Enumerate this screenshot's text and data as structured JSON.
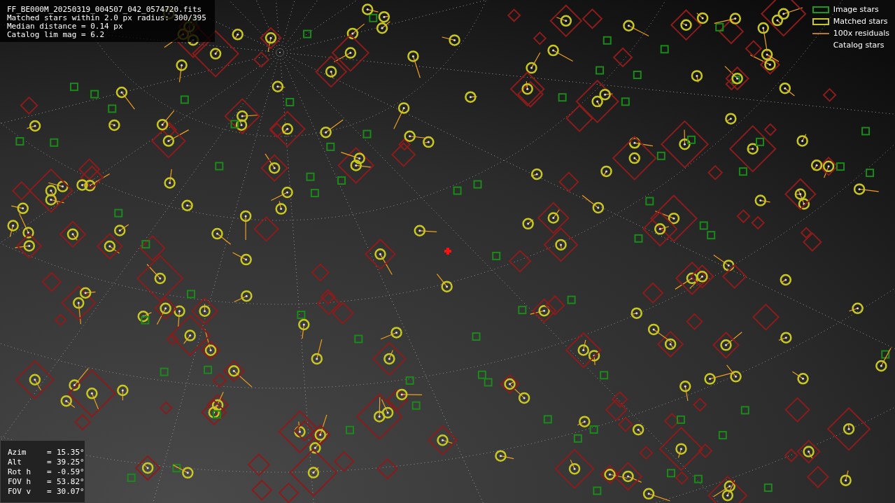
{
  "header_lines": [
    "FF_BE000M_20250319_004507_042_0574720.fits",
    "Matched stars within 2.0 px radius: 300/395",
    "Median distance = 0.14 px",
    "Catalog lim mag = 6.2"
  ],
  "legend": [
    {
      "kind": "image",
      "label": "Image stars"
    },
    {
      "kind": "matched",
      "label": "Matched stars"
    },
    {
      "kind": "residual",
      "label": "100x residuals"
    },
    {
      "kind": "catalog",
      "label": "Catalog stars"
    }
  ],
  "pointing": [
    {
      "label": "Azim",
      "sign": "=",
      "value": "15.35°"
    },
    {
      "label": "Alt",
      "sign": "=",
      "value": "39.25°"
    },
    {
      "label": "Rot h",
      "sign": "=",
      "value": "-0.59°"
    },
    {
      "label": "FOV h",
      "sign": "=",
      "value": "53.82°"
    },
    {
      "label": "FOV v",
      "sign": "=",
      "value": "30.07°"
    }
  ]
}
